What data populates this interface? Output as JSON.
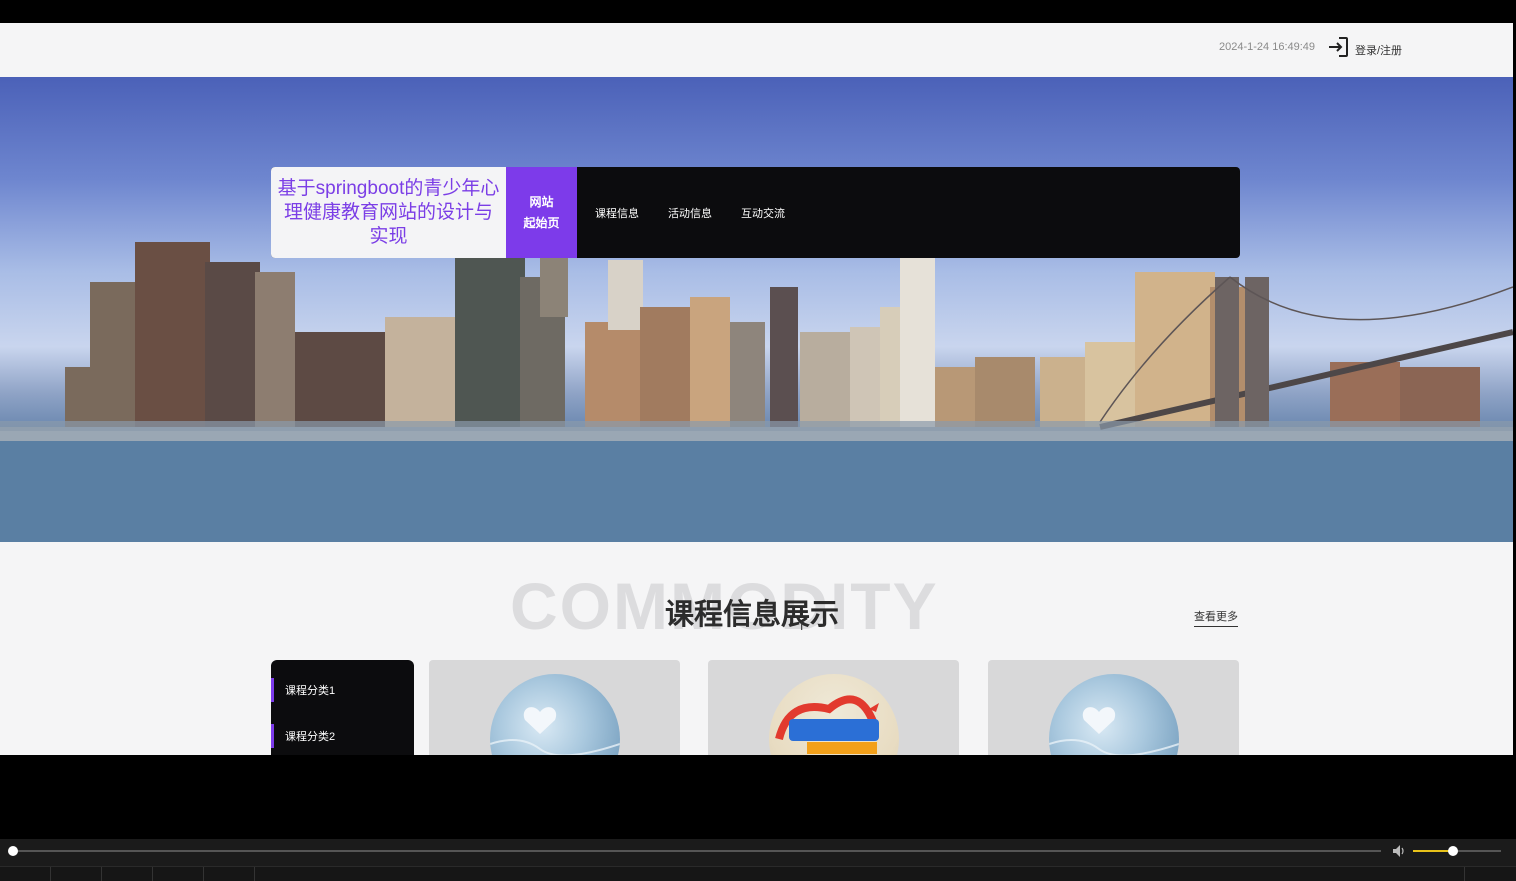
{
  "topbar": {
    "datetime": "2024-1-24 16:49:49",
    "login_label": "登录/注册"
  },
  "nav": {
    "brand": "基于springboot的青少年心理健康教育网站的设计与实现",
    "home_line1": "网站",
    "home_line2": "起始页",
    "items": [
      {
        "label": "课程信息"
      },
      {
        "label": "活动信息"
      },
      {
        "label": "互动交流"
      }
    ]
  },
  "carousel": {
    "slide_count": 3,
    "active_index": 2
  },
  "section": {
    "bg_word": "COMMODITY",
    "title": "课程信息展示",
    "more_label": "查看更多",
    "categories": [
      {
        "label": "课程分类1"
      },
      {
        "label": "课程分类2"
      }
    ],
    "cards": [
      {
        "image": "heart-image"
      },
      {
        "image": "event-poster-image"
      },
      {
        "image": "heart-image"
      }
    ]
  },
  "player": {
    "progress_fraction": 0.0,
    "volume_fraction": 0.45
  },
  "colors": {
    "accent": "#7d3bea",
    "nav_bg": "#0c0c0e",
    "page_bg": "#f5f5f6"
  }
}
